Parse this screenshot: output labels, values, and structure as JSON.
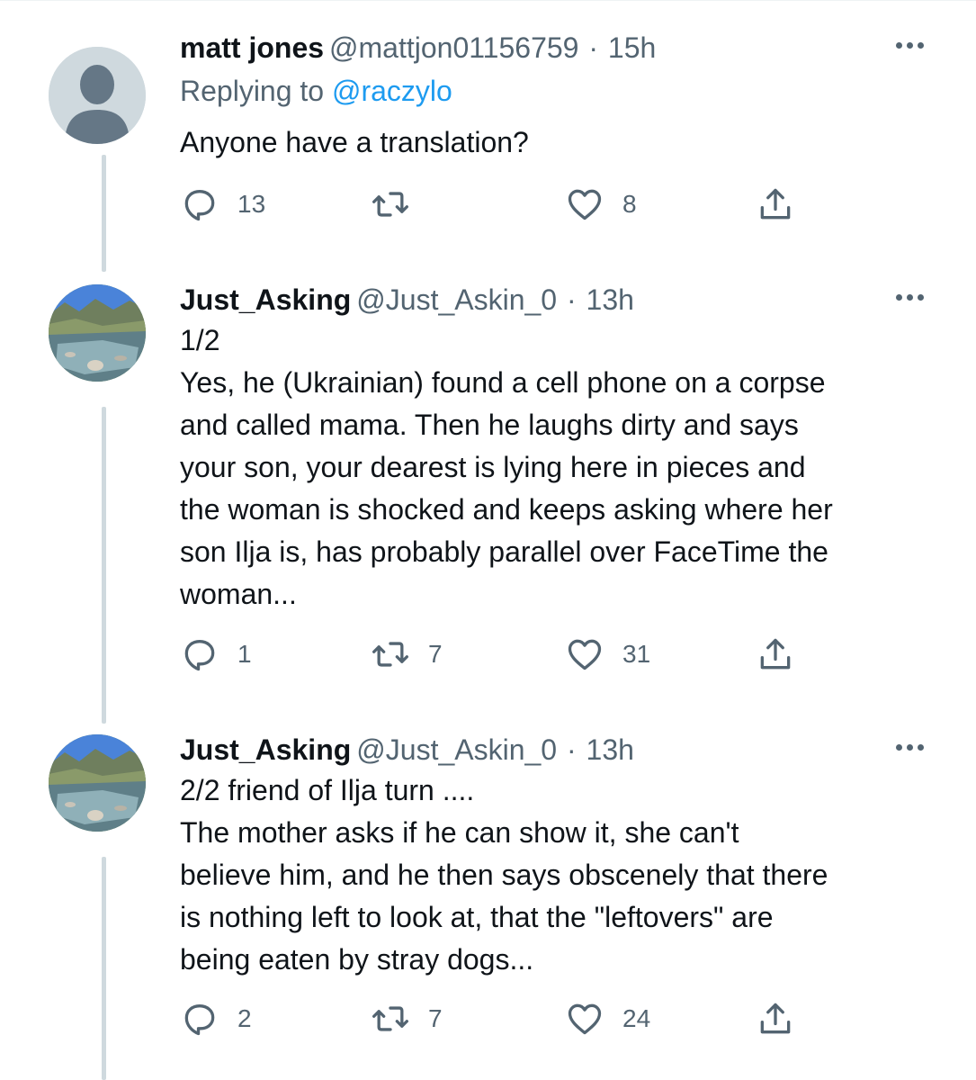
{
  "tweets": [
    {
      "name": "matt jones",
      "handle": "@mattjon01156759",
      "separator": "·",
      "time": "15h",
      "replying_prefix": "Replying to",
      "replying_handle": "@raczylo",
      "body": "Anyone have a translation?",
      "reply_count": "13",
      "retweet_count": "",
      "like_count": "8",
      "avatar": "default-profile-avatar"
    },
    {
      "name": "Just_Asking",
      "handle": "@Just_Askin_0",
      "separator": "·",
      "time": "13h",
      "body": "1/2\nYes, he (Ukrainian) found a cell phone on a corpse\nand called mama. Then he laughs dirty and says\nyour son, your dearest is lying here in pieces and\nthe woman is shocked and keeps asking where her\nson Ilja is, has probably parallel over FaceTime the\nwoman...",
      "reply_count": "1",
      "retweet_count": "7",
      "like_count": "31",
      "avatar": "mountain-river-photo"
    },
    {
      "name": "Just_Asking",
      "handle": "@Just_Askin_0",
      "separator": "·",
      "time": "13h",
      "body": "2/2 friend of Ilja turn ....\nThe mother asks if he can show it, she can't\nbelieve him, and he then says obscenely that there\nis nothing left to look at, that the \"leftovers\" are\nbeing eaten by stray dogs...",
      "reply_count": "2",
      "retweet_count": "7",
      "like_count": "24",
      "avatar": "mountain-river-photo"
    }
  ],
  "icons": {
    "more": "more-horizontal-icon",
    "reply": "reply-icon",
    "retweet": "retweet-icon",
    "like": "heart-icon",
    "share": "share-icon"
  },
  "colors": {
    "text": "#0f1419",
    "secondary": "#536471",
    "link": "#1d9bf0",
    "thread_line": "#cfd9de"
  }
}
